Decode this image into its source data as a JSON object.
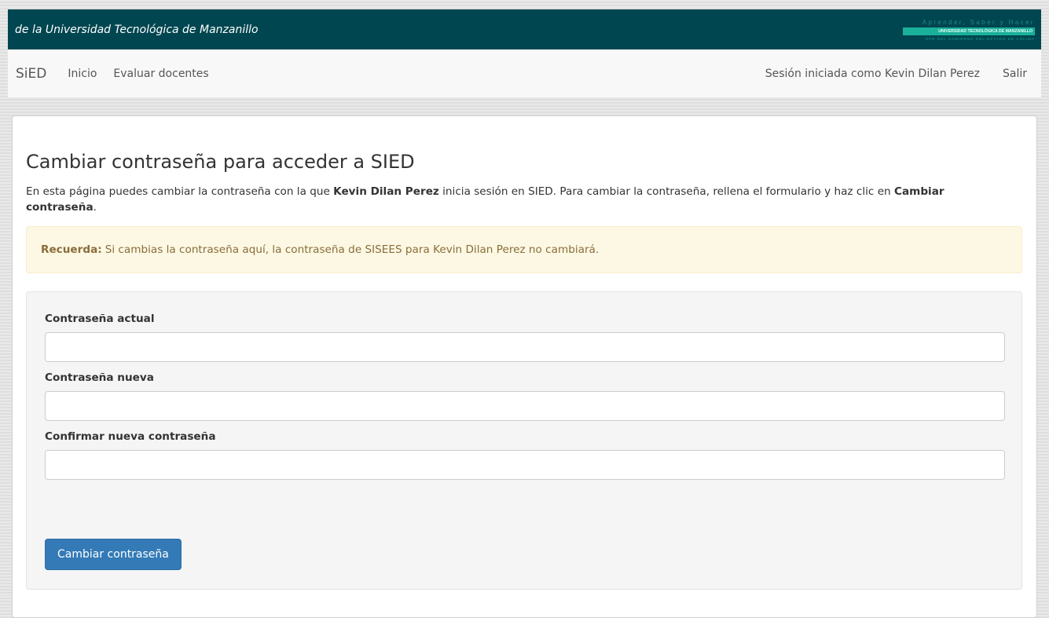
{
  "banner": {
    "title": "de la Universidad Tecnológica de Manzanillo",
    "logo_tagline": "Aprender, Saber y Hacer",
    "logo_name": "UNIVERSIDAD TECNOLÓGICA DE MANZANILLO",
    "logo_subtitle": "OPD DEL GOBIERNO DEL ESTADO DE COLIMA"
  },
  "navbar": {
    "brand": "SiED",
    "links": [
      "Inicio",
      "Evaluar docentes"
    ],
    "user_text": "Sesión iniciada como Kevin Dilan Perez",
    "logout": "Salir"
  },
  "main": {
    "title": "Cambiar contraseña para acceder a SIED",
    "intro_prefix": "En esta página puedes cambiar la contraseña con la que ",
    "intro_user": "Kevin Dilan Perez",
    "intro_mid": " inicia sesión en SIED. Para cambiar la contraseña, rellena el formulario y haz clic en ",
    "intro_action": "Cambiar contraseña",
    "intro_suffix": ".",
    "alert_label": "Recuerda:",
    "alert_text": "Si cambias la contraseña aquí, la contraseña de SISEES para Kevin Dilan Perez no cambiará."
  },
  "form": {
    "current_label": "Contraseña actual",
    "new_label": "Contraseña nueva",
    "confirm_label": "Confirmar nueva contraseña",
    "current_value": "",
    "new_value": "",
    "confirm_value": "",
    "submit_label": "Cambiar contraseña"
  },
  "colors": {
    "banner": "#004650",
    "primary": "#337ab7",
    "alert_bg": "#fcf8e3",
    "alert_text": "#8a6d3b"
  }
}
